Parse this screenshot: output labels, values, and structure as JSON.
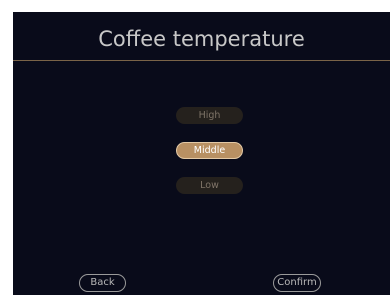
{
  "screen": {
    "title": "Coffee temperature"
  },
  "options": [
    {
      "label": "High",
      "selected": false
    },
    {
      "label": "Middle",
      "selected": true
    },
    {
      "label": "Low",
      "selected": false
    }
  ],
  "footer": {
    "back_label": "Back",
    "confirm_label": "Confirm"
  },
  "colors": {
    "background": "#090b1a",
    "accent": "#b89063",
    "divider": "#7a6448",
    "inactive_option": "#25211d"
  }
}
